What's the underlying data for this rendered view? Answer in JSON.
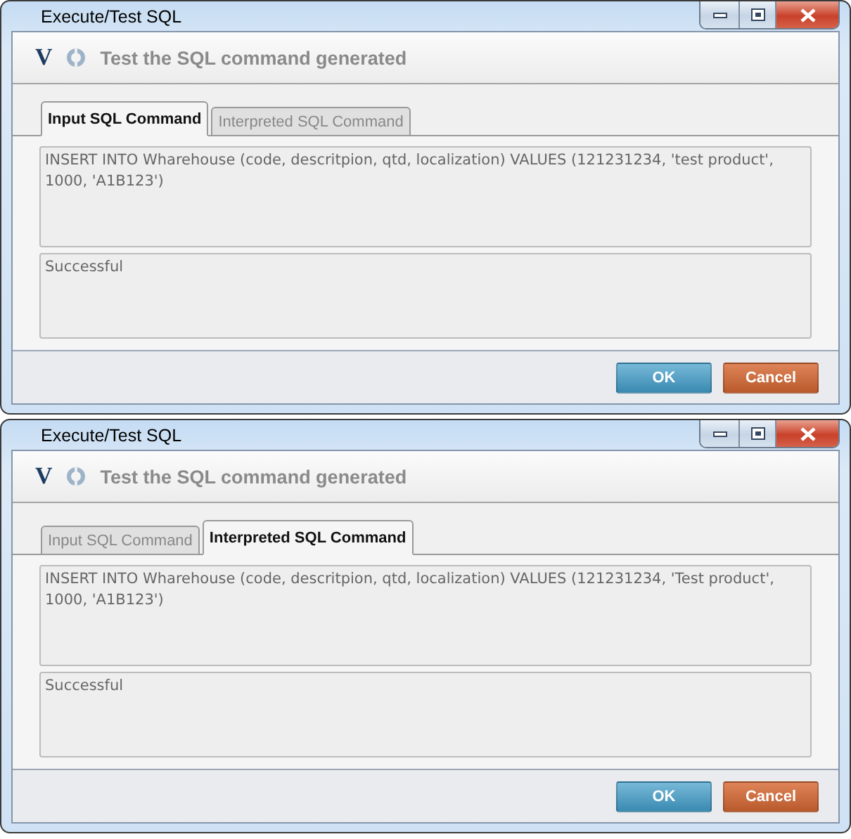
{
  "windows": [
    {
      "title": "Execute/Test SQL",
      "header": {
        "logo": "V",
        "title": "Test the SQL command generated"
      },
      "tabs": [
        {
          "label": "Input SQL Command",
          "selected": true
        },
        {
          "label": "Interpreted SQL Command",
          "selected": false
        }
      ],
      "sql_text": "INSERT INTO Wharehouse (code, descritpion, qtd, localization)  VALUES (121231234, 'test product', 1000, 'A1B123')",
      "result_text": "Successful",
      "buttons": [
        {
          "label": "OK",
          "kind": "ok"
        },
        {
          "label": "Cancel",
          "kind": "cancel"
        }
      ]
    },
    {
      "title": "Execute/Test SQL",
      "header": {
        "logo": "V",
        "title": "Test the SQL command generated"
      },
      "tabs": [
        {
          "label": "Input SQL Command",
          "selected": false
        },
        {
          "label": "Interpreted SQL Command",
          "selected": true
        }
      ],
      "sql_text": "INSERT INTO Wharehouse (code, descritpion, qtd, localization)  VALUES (121231234, 'Test product', 1000, 'A1B123')",
      "result_text": "Successful",
      "buttons": [
        {
          "label": "OK",
          "kind": "ok"
        },
        {
          "label": "Cancel",
          "kind": "cancel"
        }
      ]
    }
  ]
}
